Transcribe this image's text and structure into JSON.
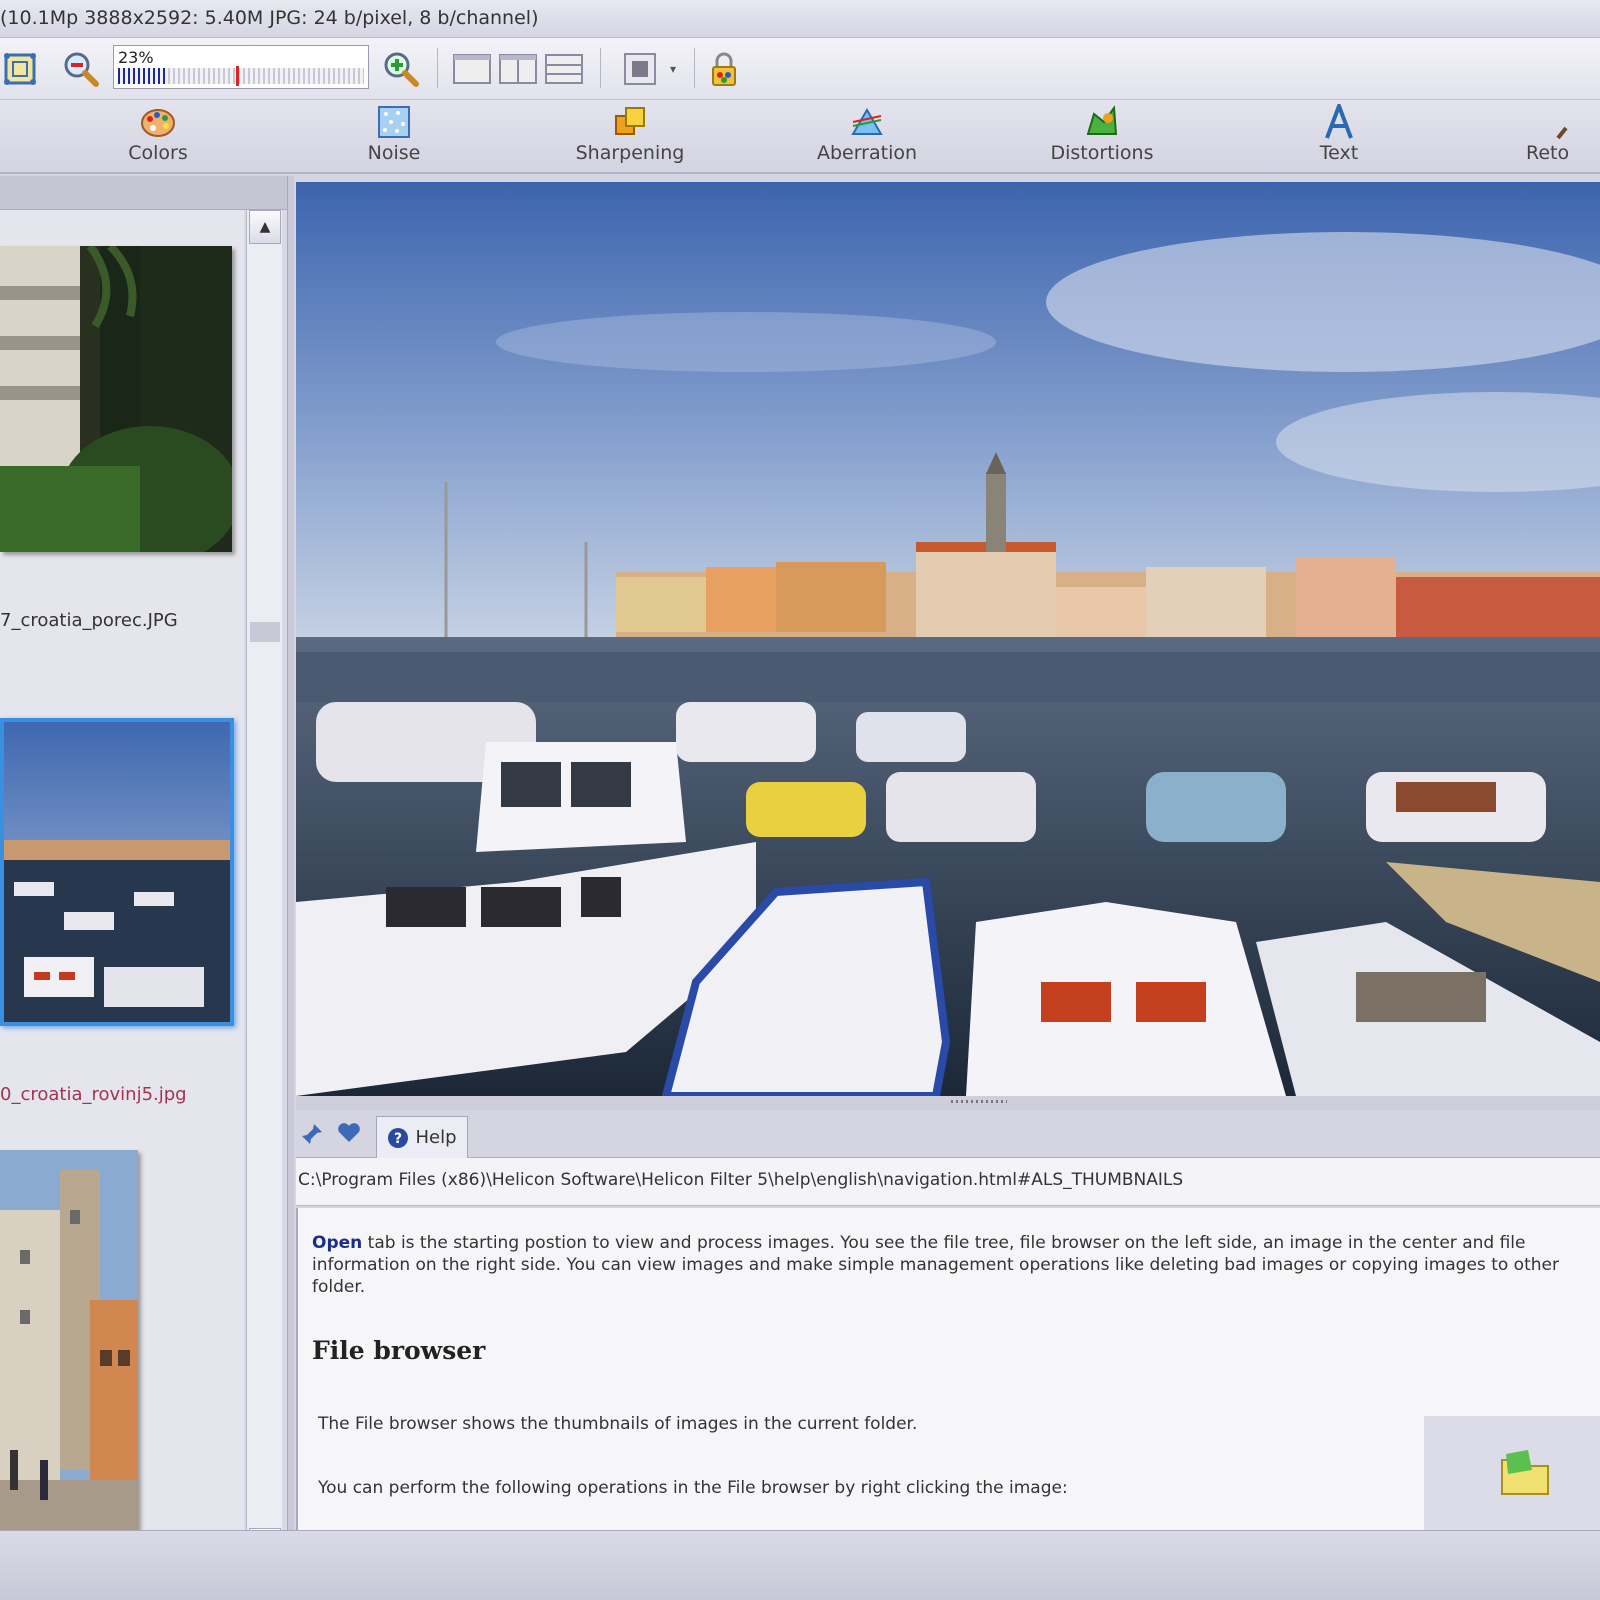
{
  "title_bar": {
    "info": "(10.1Mp 3888x2592: 5.40M JPG: 24 b/pixel, 8 b/channel)"
  },
  "toolbar": {
    "zoom_percent": "23%",
    "zoom_level": 0.23,
    "buttons": [
      "fit-icon",
      "zoom-out-icon",
      "zoom-in-icon",
      "layout-single-icon",
      "layout-split-icon",
      "layout-rows-icon",
      "fullscreen-icon",
      "lock-icon"
    ]
  },
  "filter_tabs": [
    {
      "label": "Colors",
      "icon": "palette-icon"
    },
    {
      "label": "Noise",
      "icon": "noise-icon"
    },
    {
      "label": "Sharpening",
      "icon": "sharpening-icon"
    },
    {
      "label": "Aberration",
      "icon": "aberration-icon"
    },
    {
      "label": "Distortions",
      "icon": "distortions-icon"
    },
    {
      "label": "Text",
      "icon": "text-icon"
    },
    {
      "label": "Reto",
      "icon": "retouch-icon"
    }
  ],
  "file_browser": {
    "items": [
      {
        "name": "7_croatia_porec.JPG",
        "selected": false
      },
      {
        "name": "0_croatia_rovinj5.jpg",
        "selected": true
      }
    ]
  },
  "help": {
    "tab_label": "Help",
    "path": "C:\\Program Files (x86)\\Helicon Software\\Helicon Filter 5\\help\\english\\navigation.html#ALS_THUMBNAILS",
    "intro_bold": "Open",
    "intro_text": " tab is the starting postion to view and process images. You see the file tree, file browser on the left side, an image in the center and file information on the right side. You can view images and make simple management operations like deleting bad images or copying images to other folder.",
    "heading": "File browser",
    "para1": "The File browser shows the thumbnails of images in the current folder.",
    "para2": "You can perform the following operations in the File browser by right clicking the image:"
  },
  "colors": {
    "accent": "#1b2a9a",
    "selected_border": "#3a8fe0",
    "selected_name": "#a3354f"
  }
}
